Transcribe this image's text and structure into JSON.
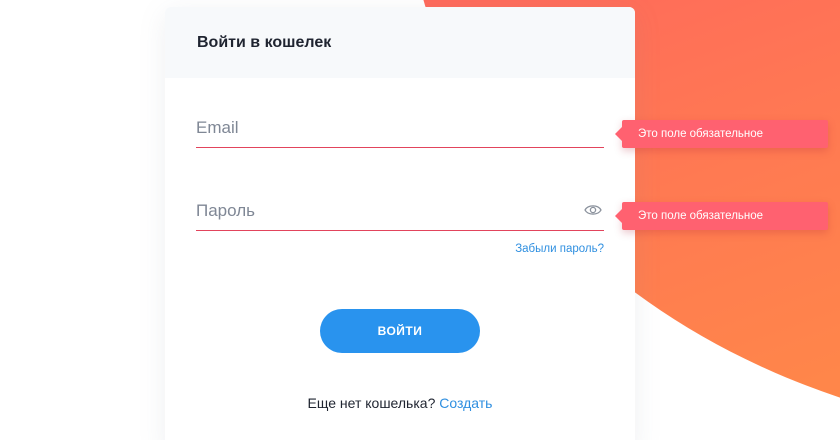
{
  "login": {
    "title": "Войти в кошелек",
    "email": {
      "value": "",
      "placeholder": "Email",
      "error": "Это поле обязательное"
    },
    "password": {
      "value": "",
      "placeholder": "Пароль",
      "error": "Это поле обязательное",
      "toggle_icon": "eye-icon"
    },
    "forgot_label": "Забыли пароль?",
    "submit_label": "ВОЙТИ",
    "signup_prompt": "Еще нет кошелька?",
    "signup_link": "Создать"
  },
  "colors": {
    "accent": "#2993ee",
    "link": "#2f8fe0",
    "error": "#ff6170",
    "error_line": "#e2445c",
    "gradient_start": "#ff4b6e",
    "gradient_end": "#ff9a3c"
  }
}
